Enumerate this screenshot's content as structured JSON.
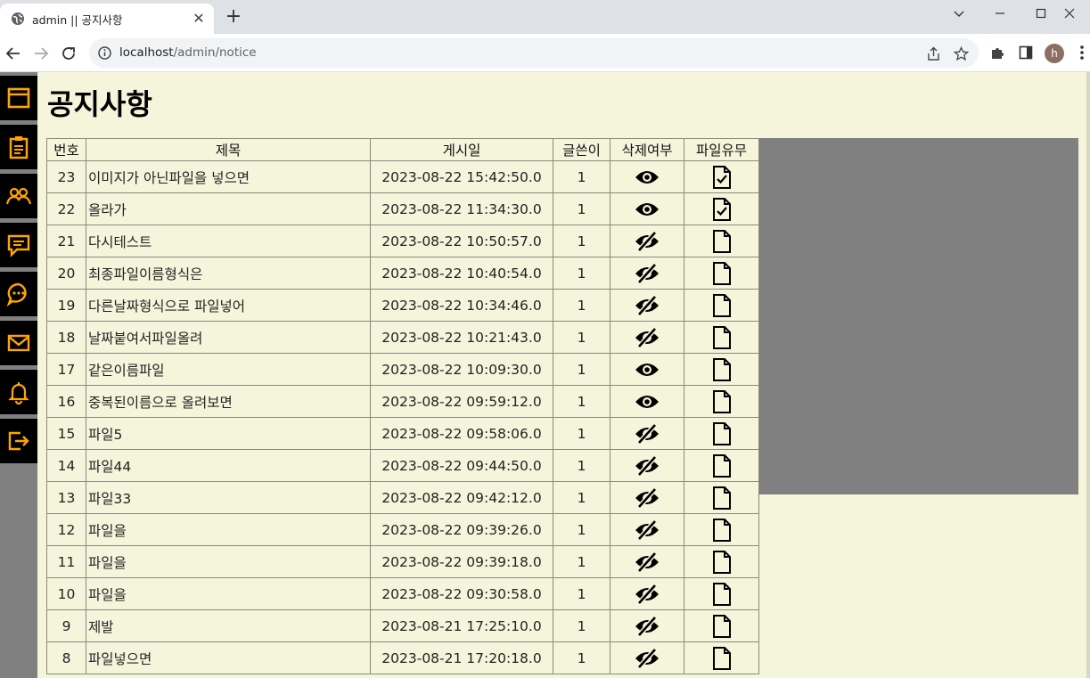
{
  "browser": {
    "tab_title": "admin || 공지사항",
    "url_host": "localhost",
    "url_path": "/admin/notice",
    "avatar_letter": "h"
  },
  "page": {
    "title": "공지사항"
  },
  "sidebar": {
    "items": [
      {
        "icon": "window-icon"
      },
      {
        "icon": "clipboard-icon"
      },
      {
        "icon": "users-icon"
      },
      {
        "icon": "message-square-icon"
      },
      {
        "icon": "chat-bubble-icon"
      },
      {
        "icon": "mail-icon"
      },
      {
        "icon": "bell-icon"
      },
      {
        "icon": "logout-icon"
      }
    ],
    "accent": "#ffa500"
  },
  "table": {
    "headers": [
      "번호",
      "제목",
      "게시일",
      "글쓴이",
      "삭제여부",
      "파일유무"
    ],
    "rows": [
      {
        "no": "23",
        "title": "이미지가 아닌파일을 넣으면",
        "date": "2023-08-22 15:42:50.0",
        "writer": "1",
        "visible": true,
        "file": true
      },
      {
        "no": "22",
        "title": "올라가",
        "date": "2023-08-22 11:34:30.0",
        "writer": "1",
        "visible": true,
        "file": true
      },
      {
        "no": "21",
        "title": "다시테스트",
        "date": "2023-08-22 10:50:57.0",
        "writer": "1",
        "visible": false,
        "file": false
      },
      {
        "no": "20",
        "title": "최종파일이름형식은",
        "date": "2023-08-22 10:40:54.0",
        "writer": "1",
        "visible": false,
        "file": false
      },
      {
        "no": "19",
        "title": "다른날짜형식으로 파일넣어",
        "date": "2023-08-22 10:34:46.0",
        "writer": "1",
        "visible": false,
        "file": false
      },
      {
        "no": "18",
        "title": "날짜붙여서파일올려",
        "date": "2023-08-22 10:21:43.0",
        "writer": "1",
        "visible": false,
        "file": false
      },
      {
        "no": "17",
        "title": "같은이름파일",
        "date": "2023-08-22 10:09:30.0",
        "writer": "1",
        "visible": true,
        "file": false
      },
      {
        "no": "16",
        "title": "중복된이름으로 올려보면",
        "date": "2023-08-22 09:59:12.0",
        "writer": "1",
        "visible": true,
        "file": false
      },
      {
        "no": "15",
        "title": "파일5",
        "date": "2023-08-22 09:58:06.0",
        "writer": "1",
        "visible": false,
        "file": false
      },
      {
        "no": "14",
        "title": "파일44",
        "date": "2023-08-22 09:44:50.0",
        "writer": "1",
        "visible": false,
        "file": false
      },
      {
        "no": "13",
        "title": "파일33",
        "date": "2023-08-22 09:42:12.0",
        "writer": "1",
        "visible": false,
        "file": false
      },
      {
        "no": "12",
        "title": "파일을",
        "date": "2023-08-22 09:39:26.0",
        "writer": "1",
        "visible": false,
        "file": false
      },
      {
        "no": "11",
        "title": "파일을",
        "date": "2023-08-22 09:39:18.0",
        "writer": "1",
        "visible": false,
        "file": false
      },
      {
        "no": "10",
        "title": "파일을",
        "date": "2023-08-22 09:30:58.0",
        "writer": "1",
        "visible": false,
        "file": false
      },
      {
        "no": "9",
        "title": "제발",
        "date": "2023-08-21 17:25:10.0",
        "writer": "1",
        "visible": false,
        "file": false
      },
      {
        "no": "8",
        "title": "파일넣으면",
        "date": "2023-08-21 17:20:18.0",
        "writer": "1",
        "visible": false,
        "file": false
      }
    ]
  }
}
